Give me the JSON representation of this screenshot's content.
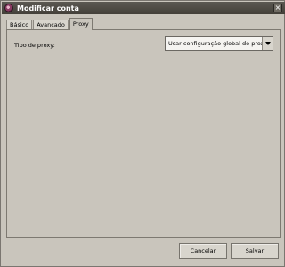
{
  "window": {
    "title": "Modificar conta"
  },
  "tabs": [
    {
      "label": "Básico",
      "active": false
    },
    {
      "label": "Avançado",
      "active": false
    },
    {
      "label": "Proxy",
      "active": true
    }
  ],
  "proxy": {
    "type_label": "Tipo de proxy:",
    "selected": "Usar configuração global de proxy"
  },
  "buttons": {
    "cancel": "Cancelar",
    "save": "Salvar"
  },
  "icons": {
    "app": "app-logo-icon",
    "close": "close-icon",
    "dropdown": "chevron-down-icon"
  }
}
